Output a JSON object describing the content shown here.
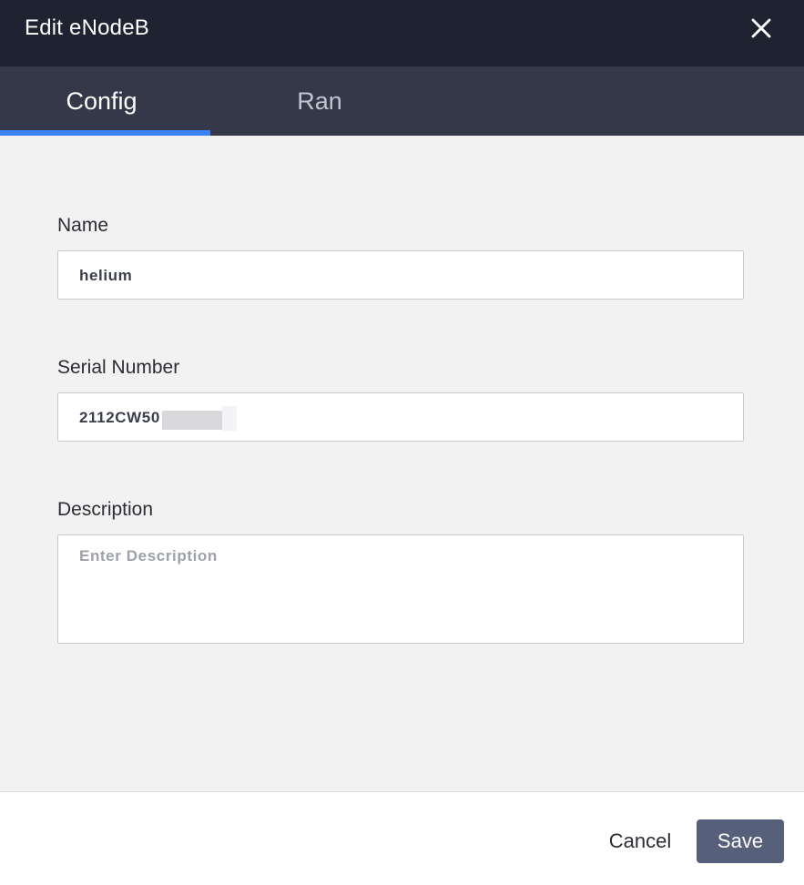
{
  "dialog": {
    "title": "Edit eNodeB"
  },
  "tabs": [
    {
      "label": "Config",
      "active": true
    },
    {
      "label": "Ran",
      "active": false
    }
  ],
  "form": {
    "name": {
      "label": "Name",
      "value": "helium"
    },
    "serial_number": {
      "label": "Serial Number",
      "value": "2112CW50",
      "redacted_suffix": true
    },
    "description": {
      "label": "Description",
      "value": "",
      "placeholder": "Enter Description"
    }
  },
  "footer": {
    "cancel_label": "Cancel",
    "save_label": "Save"
  },
  "colors": {
    "titlebar": "#1f2331",
    "tabbar": "#343848",
    "tab_indicator": "#3b82f6",
    "save_button": "#56607a",
    "body": "#f2f2f2"
  },
  "icons": {
    "close": "close-icon"
  }
}
